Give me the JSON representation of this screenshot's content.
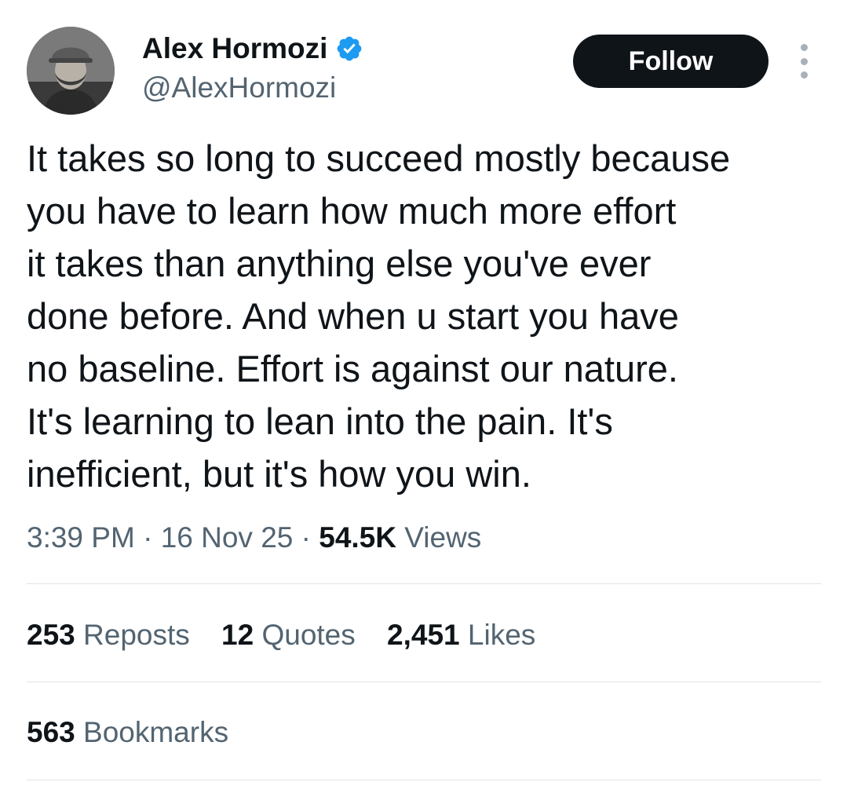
{
  "author": {
    "name": "Alex Hormozi",
    "handle": "@AlexHormozi",
    "verified_icon": "verified-badge-icon",
    "verified_color": "#1d9bf0"
  },
  "header": {
    "follow_label": "Follow",
    "more_icon": "more-vertical-icon"
  },
  "tweet": {
    "lines": [
      "It takes so long to succeed mostly because",
      "you have to learn how much more effort",
      "it takes than anything else you've ever",
      "done before. And when u start you have",
      "no baseline. Effort is against our nature.",
      "It's learning to lean into the pain. It's",
      "inefficient, but it's how you win."
    ]
  },
  "meta": {
    "time": "3:39 PM",
    "separator": "·",
    "date": "16 Nov 25",
    "views_count": "54.5K",
    "views_label": "Views"
  },
  "stats": {
    "reposts": {
      "count": "253",
      "label": "Reposts"
    },
    "quotes": {
      "count": "12",
      "label": "Quotes"
    },
    "likes": {
      "count": "2,451",
      "label": "Likes"
    },
    "bookmarks": {
      "count": "563",
      "label": "Bookmarks"
    }
  },
  "colors": {
    "text_primary": "#0f1419",
    "text_secondary": "#536471",
    "button_bg": "#0f1419",
    "divider": "#dfe3e6"
  }
}
